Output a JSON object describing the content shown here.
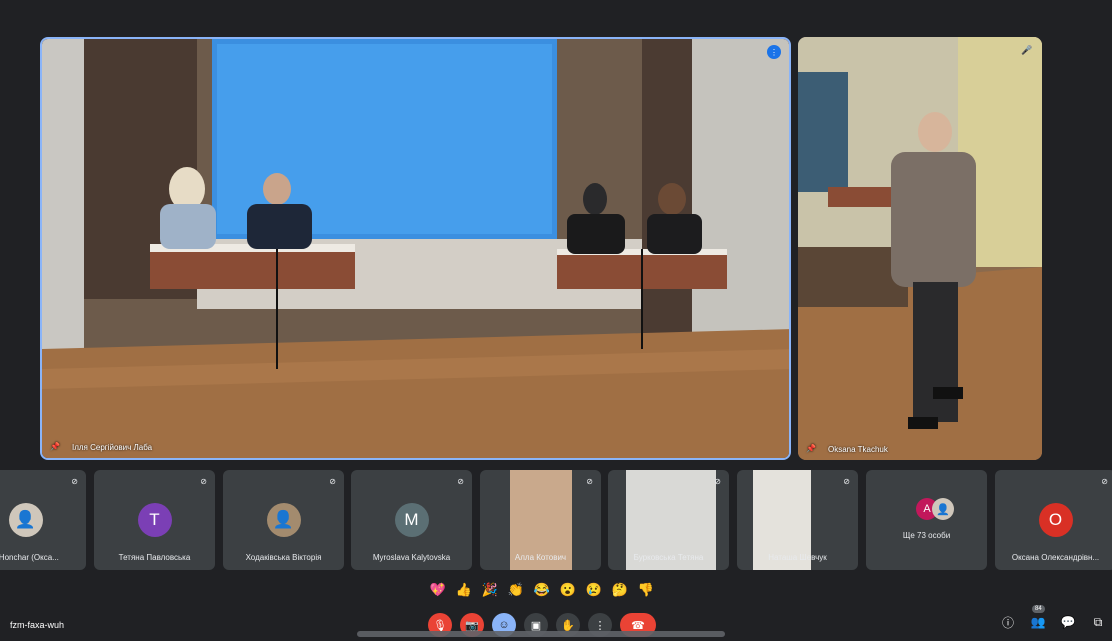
{
  "main_speaker": {
    "name": "Ілля Сергійович Лаба"
  },
  "side_speaker": {
    "name": "Oksana Tkachuk"
  },
  "participants": [
    {
      "name": "a Honchar (Окса...",
      "avatar_type": "photo",
      "color": "#cfc7bb"
    },
    {
      "name": "Тетяна Павловська",
      "avatar_letter": "T",
      "color": "#7b3fb5"
    },
    {
      "name": "Ходаківська Вікторія",
      "avatar_type": "photo",
      "color": "#a38b6e"
    },
    {
      "name": "Myroslava Kalytovska",
      "avatar_letter": "M",
      "color": "#5b6f74"
    },
    {
      "name": "Алла Котович",
      "avatar_type": "video",
      "color": "#c9a98c"
    },
    {
      "name": "Бурковська Тетяна",
      "avatar_type": "video",
      "color": "#d9d9d6"
    },
    {
      "name": "Наташа Шевчук",
      "avatar_type": "video",
      "color": "#e4e2dc"
    },
    {
      "name": "Ще 73 особи",
      "avatar_letter": "A",
      "color": "#c2185b"
    },
    {
      "name": "Оксана Олександрівн...",
      "avatar_letter": "O",
      "color": "#d93025"
    }
  ],
  "reactions": [
    "💖",
    "👍",
    "🎉",
    "👏",
    "😂",
    "😮",
    "😢",
    "🤔",
    "👎"
  ],
  "meeting_code": "fzm-faxa-wuh",
  "participant_count": "84",
  "controls": {
    "mic_icon": "mic-off-icon",
    "cam_icon": "camera-off-icon",
    "emoji_icon": "emoji-icon",
    "present_icon": "present-icon",
    "hand_icon": "raise-hand-icon",
    "more_icon": "more-options-icon",
    "end_icon": "end-call-icon"
  }
}
